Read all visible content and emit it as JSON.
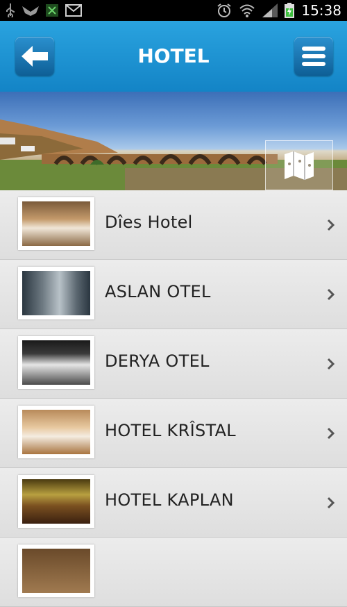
{
  "statusbar": {
    "time": "15:38",
    "icons_left": [
      "usb-icon",
      "winged-app-icon",
      "x-app-icon",
      "mail-icon"
    ],
    "icons_right": [
      "alarm-icon",
      "wifi-icon",
      "signal-icon",
      "battery-charging-icon"
    ]
  },
  "header": {
    "title": "HOTEL",
    "back_icon": "back-arrow-icon",
    "menu_icon": "menu-icon",
    "accent_color": "#1a8fd2"
  },
  "banner": {
    "map_icon": "map-icon"
  },
  "hotels": [
    {
      "name": "Dîes Hotel"
    },
    {
      "name": "ASLAN OTEL"
    },
    {
      "name": "DERYA OTEL"
    },
    {
      "name": "HOTEL KRÎSTAL"
    },
    {
      "name": "HOTEL KAPLAN"
    },
    {
      "name": ""
    }
  ]
}
